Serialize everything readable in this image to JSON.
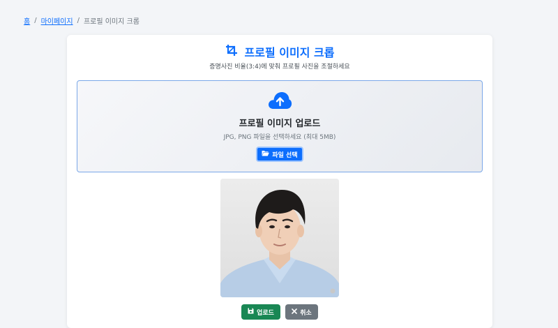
{
  "breadcrumb": {
    "home": "홈",
    "sep": "/",
    "mypage": "마이페이지",
    "current": "프로필 이미지 크롭"
  },
  "header": {
    "title": "프로필 이미지 크롭",
    "subtitle": "증명사진 비율(3:4)에 맞춰 프로필 사진을 조절하세요",
    "icon": "crop-icon"
  },
  "upload": {
    "icon": "cloud-upload-icon",
    "title": "프로필 이미지 업로드",
    "hint": "JPG, PNG 파일을 선택하세요 (최대 5MB)",
    "button_label": "파일 선택",
    "button_icon": "folder-open-icon"
  },
  "preview": {
    "image": "profile-photo"
  },
  "actions": {
    "upload_label": "업로드",
    "upload_icon": "save-icon",
    "cancel_label": "취소",
    "cancel_icon": "close-icon"
  },
  "colors": {
    "primary": "#0d6efd",
    "success": "#198754",
    "secondary": "#6c757d",
    "background": "#f3f5f8"
  }
}
